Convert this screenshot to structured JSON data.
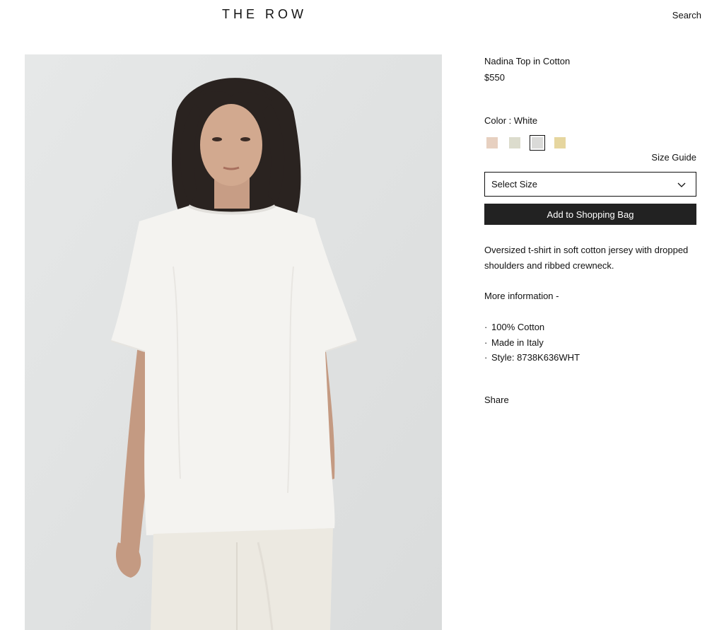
{
  "header": {
    "logo": "THE ROW",
    "search_label": "Search"
  },
  "product": {
    "name": "Nadina Top in Cotton",
    "price": "$550",
    "color_label": "Color : White",
    "swatches": [
      {
        "name": "swatch-blush",
        "color": "#e7d0c0",
        "selected": false
      },
      {
        "name": "swatch-sage",
        "color": "#dcdccd",
        "selected": false
      },
      {
        "name": "swatch-white",
        "color": "#dadad8",
        "selected": true
      },
      {
        "name": "swatch-butter",
        "color": "#e6d69f",
        "selected": false
      }
    ],
    "size_guide_label": "Size Guide",
    "size_select_value": "Select Size",
    "add_to_bag_label": "Add to Shopping Bag",
    "description": "Oversized t-shirt in soft cotton jersey with dropped shoulders and ribbed crewneck.",
    "more_info_label": "More information -",
    "details": [
      {
        "bullet": "·",
        "text": "100% Cotton"
      },
      {
        "bullet": "·",
        "text": "Made in Italy"
      },
      {
        "bullet": "·",
        "text": "Style: 8738K636WHT"
      }
    ],
    "share_label": "Share"
  },
  "image": {
    "icon": "product-photo",
    "background": "#e3e5e6"
  }
}
